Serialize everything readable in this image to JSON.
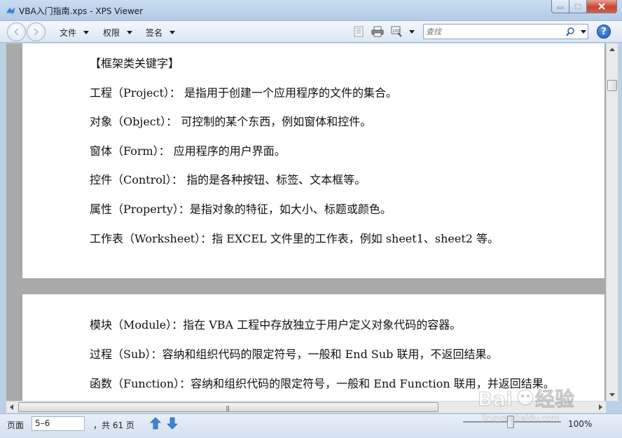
{
  "window": {
    "title": "VBA入门指南.xps - XPS Viewer"
  },
  "toolbar": {
    "menus": [
      {
        "label": "文件"
      },
      {
        "label": "权限"
      },
      {
        "label": "签名"
      }
    ],
    "search_placeholder": "查找"
  },
  "document": {
    "page1_lines": [
      "【框架类关键字】",
      "工程（Project）：  是指用于创建一个应用程序的文件的集合。",
      "对象（Object）：  可控制的某个东西，例如窗体和控件。",
      "窗体（Form）：  应用程序的用户界面。",
      "控件（Control）：  指的是各种按钮、标签、文本框等。",
      "属性（Property）：是指对象的特征，如大小、标题或颜色。",
      "工作表（Worksheet）：指 EXCEL 文件里的工作表，例如 sheet1、sheet2 等。"
    ],
    "page2_lines": [
      "模块（Module）：指在 VBA 工程中存放独立于用户定义对象代码的容器。",
      "过程（Sub）：容纳和组织代码的限定符号，一般和 End Sub 联用，不返回结果。",
      "函数（Function）：容纳和组织代码的限定符号，一般和 End Function 联用，并返回结果。"
    ]
  },
  "statusbar": {
    "page_label": "页面",
    "page_value": "5–6",
    "total_pages": "，共 61 页",
    "zoom": "100%",
    "zoom_fraction": 0.45
  },
  "watermark": {
    "text": "Baidu经验",
    "url": "jingyan.baidu.com"
  },
  "colors": {
    "titlebar": "#c4d8ee",
    "close_button": "#c7452f",
    "page_background": "#ffffff",
    "viewer_background": "#a9a9a9",
    "nav_arrow": "#3b87d9"
  }
}
